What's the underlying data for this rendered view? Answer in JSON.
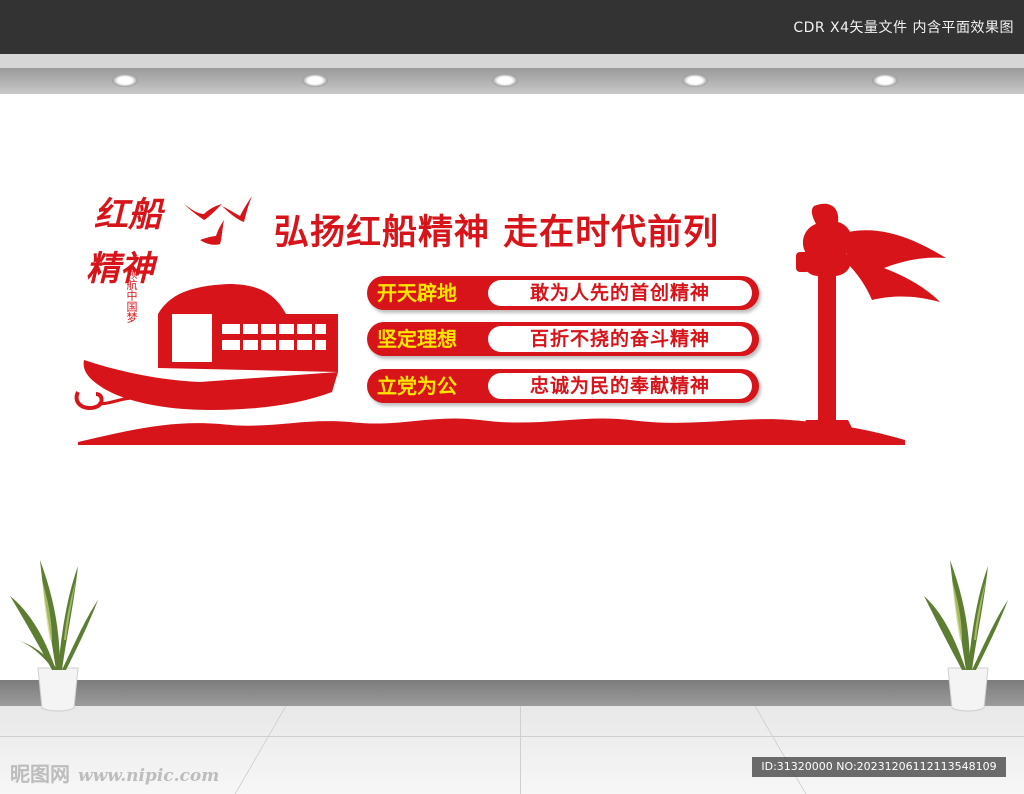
{
  "header": {
    "text": "CDR X4矢量文件  内含平面效果图"
  },
  "calligraphy": {
    "line1": "红船",
    "line2": "精神"
  },
  "subtitle": "领航中国梦",
  "title": "弘扬红船精神  走在时代前列",
  "slogans": [
    {
      "key": "开天辟地",
      "value": "敢为人先的首创精神"
    },
    {
      "key": "坚定理想",
      "value": "百折不挠的奋斗精神"
    },
    {
      "key": "立党为公",
      "value": "忠诚为民的奉献精神"
    }
  ],
  "watermark": {
    "brand": "昵图网",
    "site": "www.nipic.com"
  },
  "image_id": "ID:31320000 NO:20231206112113548109",
  "colors": {
    "accent_red": "#d7141a",
    "key_yellow": "#ffe600"
  },
  "icons": [
    "bird-icon",
    "red-boat-icon",
    "huabiao-pillar-icon",
    "potted-plant-icon",
    "downlight-icon"
  ]
}
